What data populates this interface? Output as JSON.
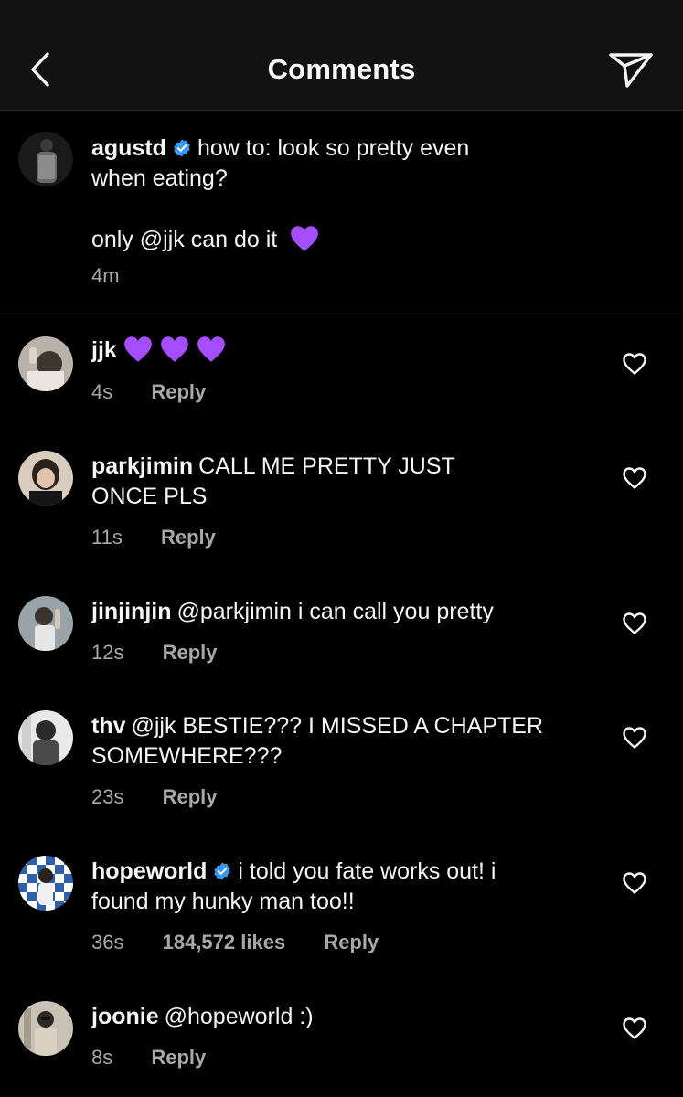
{
  "header": {
    "title": "Comments"
  },
  "caption": {
    "username": "agustd",
    "line1": "how to: look so pretty even",
    "line2": "when eating?",
    "line3": "only @jjk can do it",
    "time": "4m"
  },
  "comments": [
    {
      "username": "jjk",
      "time": "4s",
      "reply_label": "Reply"
    },
    {
      "username": "parkjimin",
      "text1": "CALL ME PRETTY JUST",
      "text2": "ONCE PLS",
      "time": "11s",
      "reply_label": "Reply"
    },
    {
      "username": "jinjinjin",
      "text1": "@parkjimin i can call you pretty",
      "time": "12s",
      "reply_label": "Reply"
    },
    {
      "username": "thv",
      "text1": "@jjk BESTIE??? I MISSED A CHAPTER",
      "text2": "SOMEWHERE???",
      "time": "23s",
      "reply_label": "Reply"
    },
    {
      "username": "hopeworld",
      "text1": "i told you fate works out! i",
      "text2": "found my hunky man too!!",
      "time": "36s",
      "likes": "184,572 likes",
      "reply_label": "Reply"
    },
    {
      "username": "joonie",
      "text1": "@hopeworld :)",
      "time": "8s",
      "reply_label": "Reply"
    }
  ],
  "colors": {
    "background": "#000000",
    "header_bg": "#121212",
    "text": "#f5f5f5",
    "secondary": "#a8a8a8",
    "verified": "#3897f0",
    "purple_heart": "#a64dff"
  },
  "icons": [
    "chevron-left-icon",
    "send-icon",
    "verified-badge-icon",
    "heart-outline-icon",
    "purple-heart-emoji"
  ]
}
